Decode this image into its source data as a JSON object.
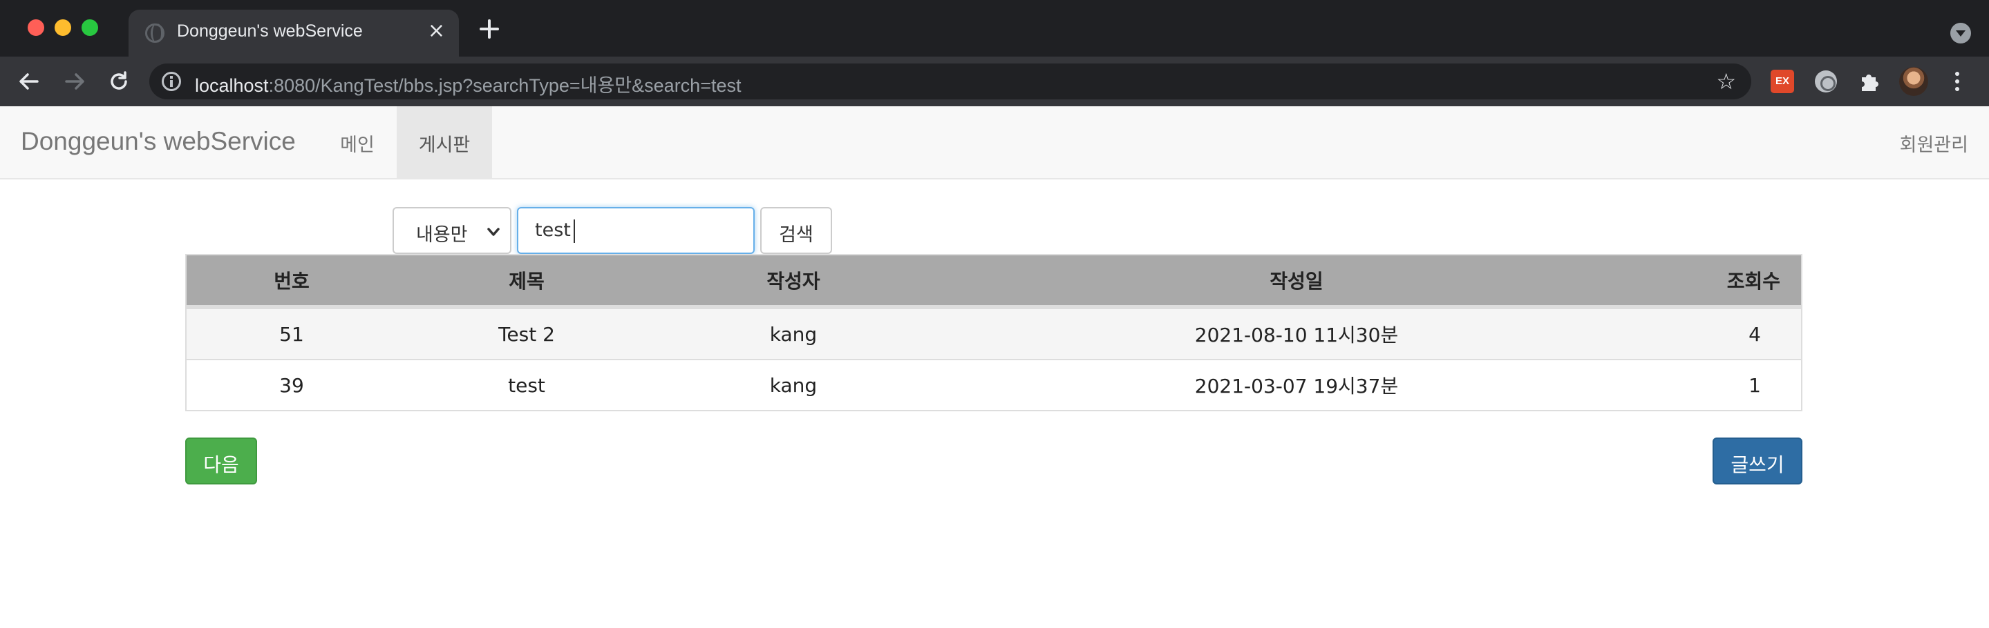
{
  "browser": {
    "tab": {
      "title": "Donggeun's webService",
      "close_glyph": "×"
    },
    "address": {
      "host": "localhost",
      "rest": ":8080/KangTest/bbs.jsp?searchType=내용만&search=test"
    },
    "extensions": {
      "ex_label": "EX"
    },
    "icons": [
      "back-icon",
      "forward-icon",
      "reload-icon",
      "info-icon",
      "star-icon",
      "puzzle-icon",
      "kebab-icon"
    ]
  },
  "navbar": {
    "brand": "Donggeun's webService",
    "items": [
      {
        "label": "메인",
        "active": false
      },
      {
        "label": "게시판",
        "active": true
      }
    ],
    "right_item": "회원관리"
  },
  "search": {
    "type_selected": "내용만",
    "query": "test",
    "button_label": "검색"
  },
  "table": {
    "headers": [
      "번호",
      "제목",
      "작성자",
      "작성일",
      "조회수"
    ],
    "rows": [
      {
        "no": "51",
        "title": "Test 2",
        "author": "kang",
        "date": "2021-08-10 11시30분",
        "views": "4"
      },
      {
        "no": "39",
        "title": "test",
        "author": "kang",
        "date": "2021-03-07 19시37분",
        "views": "1"
      }
    ]
  },
  "buttons": {
    "next_label": "다음",
    "write_label": "글쓰기"
  },
  "colors": {
    "header_bg": "#a9a9a9",
    "next_button": "#4cae4c",
    "write_button": "#2e6da4",
    "input_focus": "#66afe9"
  }
}
